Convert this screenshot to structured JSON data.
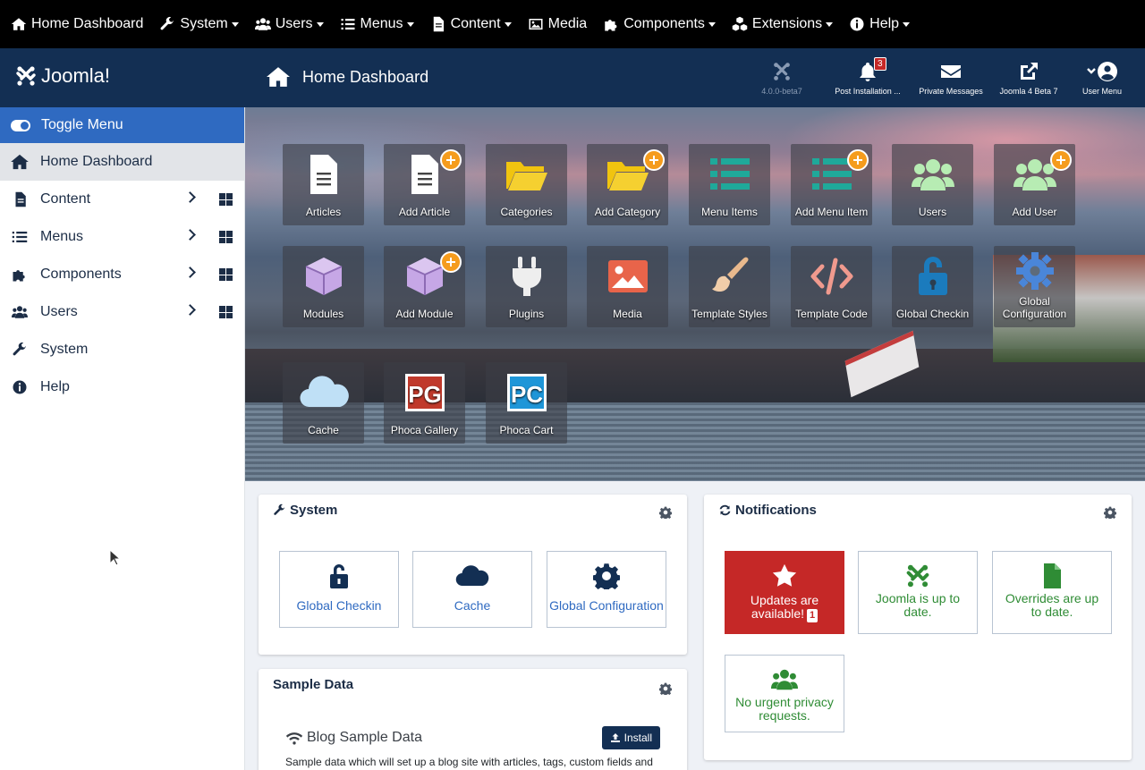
{
  "topmenu": {
    "home": "Home Dashboard",
    "system": "System",
    "users": "Users",
    "menus": "Menus",
    "content": "Content",
    "media": "Media",
    "components": "Components",
    "extensions": "Extensions",
    "help": "Help"
  },
  "header": {
    "logo_text": "Joomla!",
    "title": "Home Dashboard",
    "icons": {
      "version": "4.0.0-beta7",
      "post_install": "Post Installation ...",
      "post_install_count": "3",
      "messages": "Private Messages",
      "site": "Joomla 4 Beta 7",
      "user": "User Menu"
    }
  },
  "sidebar": {
    "toggle": "Toggle Menu",
    "items": [
      {
        "label": "Home Dashboard"
      },
      {
        "label": "Content"
      },
      {
        "label": "Menus"
      },
      {
        "label": "Components"
      },
      {
        "label": "Users"
      },
      {
        "label": "System"
      },
      {
        "label": "Help"
      }
    ]
  },
  "tiles": [
    "Articles",
    "Add Article",
    "Categories",
    "Add Category",
    "Menu Items",
    "Add Menu Item",
    "Users",
    "Add User",
    "Modules",
    "Add Module",
    "Plugins",
    "Media",
    "Template Styles",
    "Template Code",
    "Global Checkin",
    "Global Configuration",
    "Cache",
    "Phoca Gallery",
    "Phoca Cart"
  ],
  "tile_icon_text": {
    "pg": "PG",
    "pc": "PC"
  },
  "system_card": {
    "title": "System",
    "buttons": [
      "Global Checkin",
      "Cache",
      "Global Configuration"
    ]
  },
  "notifications_card": {
    "title": "Notifications",
    "updates": "Updates are available!",
    "updates_count": "1",
    "joomla": "Joomla is up to date.",
    "overrides": "Overrides are up to date.",
    "privacy": "No urgent privacy requests."
  },
  "sample_card": {
    "title": "Sample Data",
    "item": "Blog Sample Data",
    "install": "Install",
    "description": "Sample data which will set up a blog site with articles, tags, custom fields and"
  },
  "colors": {
    "header_bg": "#132f53",
    "accent": "#2f6ac1",
    "danger": "#c52827",
    "success": "#2f8c35",
    "plus": "#f59c1d"
  }
}
